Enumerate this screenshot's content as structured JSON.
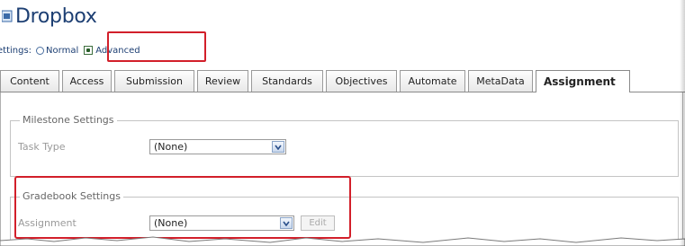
{
  "title": "Dropbox",
  "settings": {
    "label": "ettings:",
    "normal": "Normal",
    "advanced": "Advanced"
  },
  "tabs": [
    {
      "label": "Content"
    },
    {
      "label": "Access"
    },
    {
      "label": "Submission"
    },
    {
      "label": "Review"
    },
    {
      "label": "Standards"
    },
    {
      "label": "Objectives"
    },
    {
      "label": "Automate"
    },
    {
      "label": "MetaData"
    },
    {
      "label": "Assignment"
    }
  ],
  "milestone": {
    "legend": "Milestone Settings",
    "task_type_label": "Task Type",
    "task_type_value": "(None)"
  },
  "gradebook": {
    "legend": "Gradebook Settings",
    "assignment_label": "Assignment",
    "assignment_value": "(None)",
    "edit_label": "Edit"
  },
  "colors": {
    "highlight": "#d21f2a",
    "title": "#1d3f73"
  }
}
